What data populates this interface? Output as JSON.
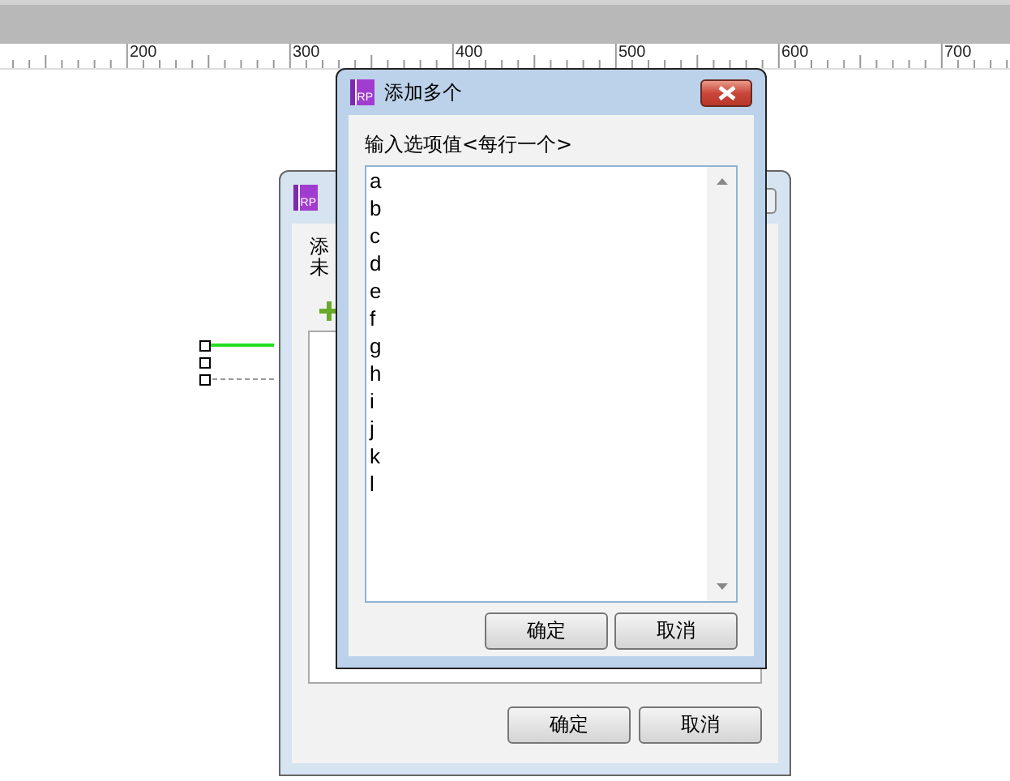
{
  "ruler": {
    "labels": [
      "200",
      "300",
      "400",
      "500",
      "600",
      "700"
    ]
  },
  "back_dialog": {
    "logo": "RP",
    "texts": [
      "添",
      "未"
    ],
    "buttons": [
      "确定",
      "取消"
    ]
  },
  "dialog": {
    "logo": "RP",
    "title": "添加多个",
    "label": "输入选项值<每行一个>",
    "value": "a\nb\nc\nd\ne\nf\ng\nh\ni\nj\nk\nl",
    "buttons": [
      "确定",
      "取消"
    ]
  }
}
